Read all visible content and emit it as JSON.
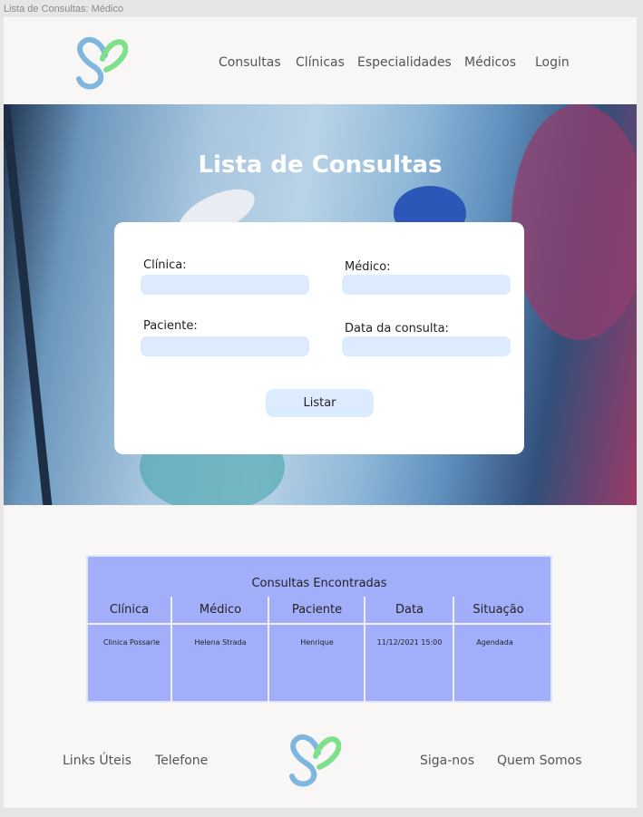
{
  "window": {
    "title": "Lista de Consultas: Médico"
  },
  "nav": {
    "items": [
      {
        "label": "Consultas"
      },
      {
        "label": "Clínicas"
      },
      {
        "label": "Especialidades"
      },
      {
        "label": "Médicos"
      },
      {
        "label": "Login"
      }
    ]
  },
  "hero": {
    "title": "Lista de Consultas"
  },
  "form": {
    "clinica_label": "Clínica:",
    "medico_label": "Médico:",
    "paciente_label": "Paciente:",
    "data_label": "Data da consulta:",
    "clinica_value": "",
    "medico_value": "",
    "paciente_value": "",
    "data_value": "",
    "submit_label": "Listar"
  },
  "results": {
    "caption": "Consultas Encontradas",
    "columns": [
      "Clínica",
      "Médico",
      "Paciente",
      "Data",
      "Situação"
    ],
    "rows": [
      [
        "Clinica Possarle",
        "Helena Strada",
        "Henrique",
        "11/12/2021 15:00",
        "Agendada"
      ]
    ]
  },
  "footer": {
    "links_uteis": "Links Úteis",
    "telefone": "Telefone",
    "siga_nos": "Siga-nos",
    "quem_somos": "Quem Somos"
  },
  "colors": {
    "page_bg": "#f8f7f5",
    "input_bg": "#dcebfd",
    "table_bg": "#a3aefa",
    "logo_blue": "#7fb6e0",
    "logo_green": "#7ee08a"
  }
}
